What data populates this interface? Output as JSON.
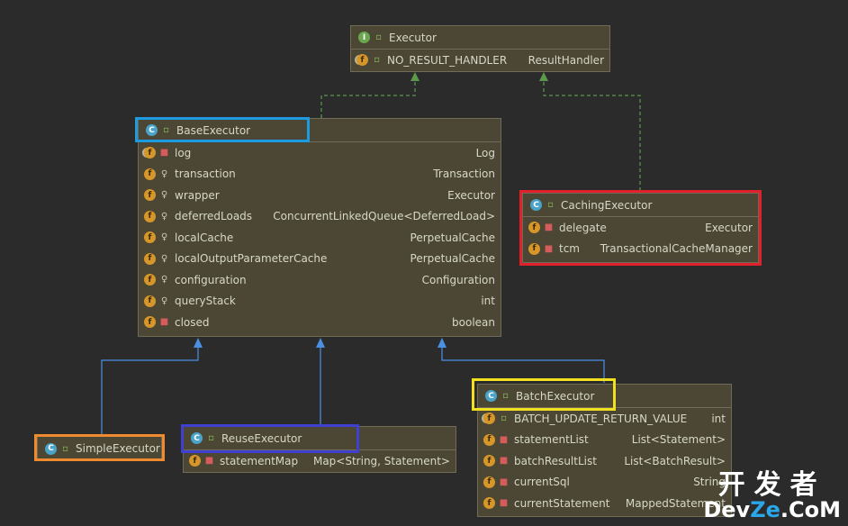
{
  "classes": {
    "executor": {
      "kind": "I",
      "name": "Executor",
      "fields": [
        {
          "name": "NO_RESULT_HANDLER",
          "type": "ResultHandler",
          "icon": "static-field",
          "vis": "public"
        }
      ]
    },
    "base_executor": {
      "kind": "C",
      "name": "BaseExecutor",
      "fields": [
        {
          "name": "log",
          "type": "Log",
          "icon": "static-field",
          "vis": "private"
        },
        {
          "name": "transaction",
          "type": "Transaction",
          "icon": "field",
          "vis": "protected"
        },
        {
          "name": "wrapper",
          "type": "Executor",
          "icon": "field",
          "vis": "protected"
        },
        {
          "name": "deferredLoads",
          "type": "ConcurrentLinkedQueue<DeferredLoad>",
          "icon": "field",
          "vis": "protected"
        },
        {
          "name": "localCache",
          "type": "PerpetualCache",
          "icon": "field",
          "vis": "protected"
        },
        {
          "name": "localOutputParameterCache",
          "type": "PerpetualCache",
          "icon": "field",
          "vis": "protected"
        },
        {
          "name": "configuration",
          "type": "Configuration",
          "icon": "field",
          "vis": "protected"
        },
        {
          "name": "queryStack",
          "type": "int",
          "icon": "field",
          "vis": "protected"
        },
        {
          "name": "closed",
          "type": "boolean",
          "icon": "field",
          "vis": "private"
        }
      ]
    },
    "caching_executor": {
      "kind": "C",
      "name": "CachingExecutor",
      "fields": [
        {
          "name": "delegate",
          "type": "Executor",
          "icon": "field",
          "vis": "private"
        },
        {
          "name": "tcm",
          "type": "TransactionalCacheManager",
          "icon": "field",
          "vis": "private"
        }
      ]
    },
    "simple_executor": {
      "kind": "C",
      "name": "SimpleExecutor",
      "fields": []
    },
    "reuse_executor": {
      "kind": "C",
      "name": "ReuseExecutor",
      "fields": [
        {
          "name": "statementMap",
          "type": "Map<String, Statement>",
          "icon": "field",
          "vis": "private"
        }
      ]
    },
    "batch_executor": {
      "kind": "C",
      "name": "BatchExecutor",
      "fields": [
        {
          "name": "BATCH_UPDATE_RETURN_VALUE",
          "type": "int",
          "icon": "static-field",
          "vis": "public"
        },
        {
          "name": "statementList",
          "type": "List<Statement>",
          "icon": "field",
          "vis": "private"
        },
        {
          "name": "batchResultList",
          "type": "List<BatchResult>",
          "icon": "field",
          "vis": "private"
        },
        {
          "name": "currentSql",
          "type": "String",
          "icon": "field",
          "vis": "private"
        },
        {
          "name": "currentStatement",
          "type": "MappedStatement",
          "icon": "field",
          "vis": "private"
        }
      ]
    }
  },
  "highlight_colors": {
    "base_executor": "#1e9be0",
    "caching_executor": "#e0202a",
    "batch_executor": "#f0e020",
    "simple_executor": "#f08a30",
    "reuse_executor": "#4040d0"
  },
  "edge_colors": {
    "implements": "#5a9a4a",
    "extends": "#4a90e2"
  },
  "watermark": {
    "cn": "开发者",
    "en_prefix": "Dev",
    "en_mid": "Ze",
    "en_suffix": ".CoM"
  }
}
